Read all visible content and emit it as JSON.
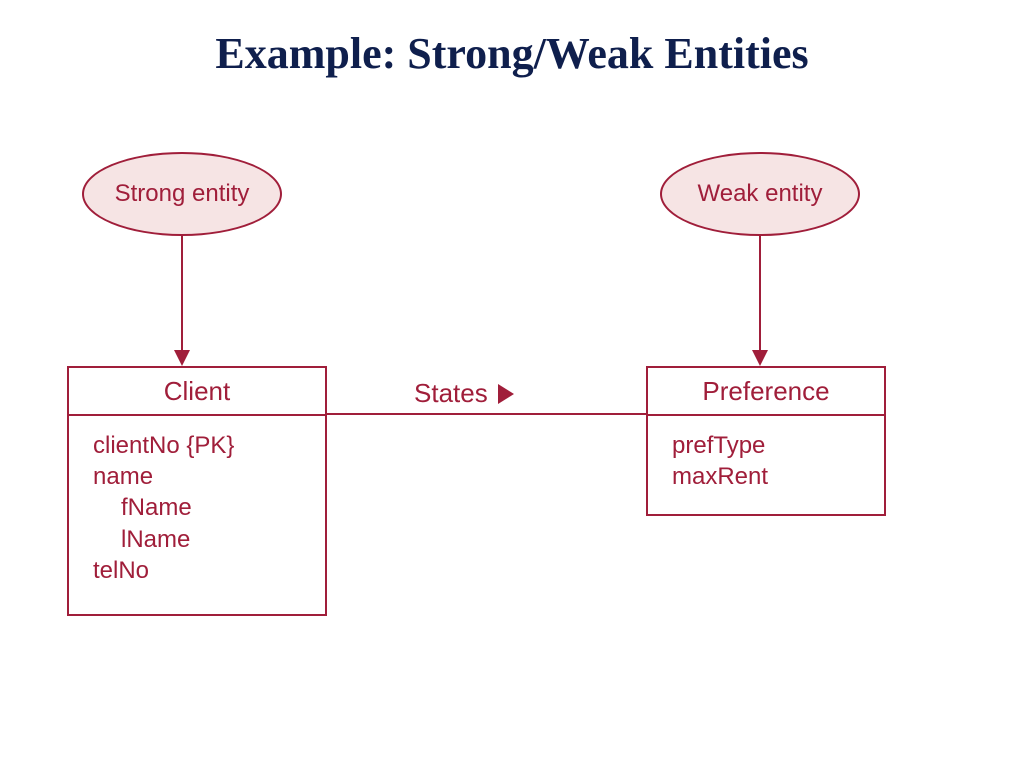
{
  "title": "Example: Strong/Weak Entities",
  "callouts": {
    "strong": "Strong entity",
    "weak": "Weak entity"
  },
  "relationship": "States",
  "entities": {
    "client": {
      "name": "Client",
      "attrs": {
        "pk": "clientNo {PK}",
        "name": "name",
        "fName": "fName",
        "lName": "lName",
        "telNo": "telNo"
      }
    },
    "preference": {
      "name": "Preference",
      "attrs": {
        "prefType": "prefType",
        "maxRent": "maxRent"
      }
    }
  }
}
